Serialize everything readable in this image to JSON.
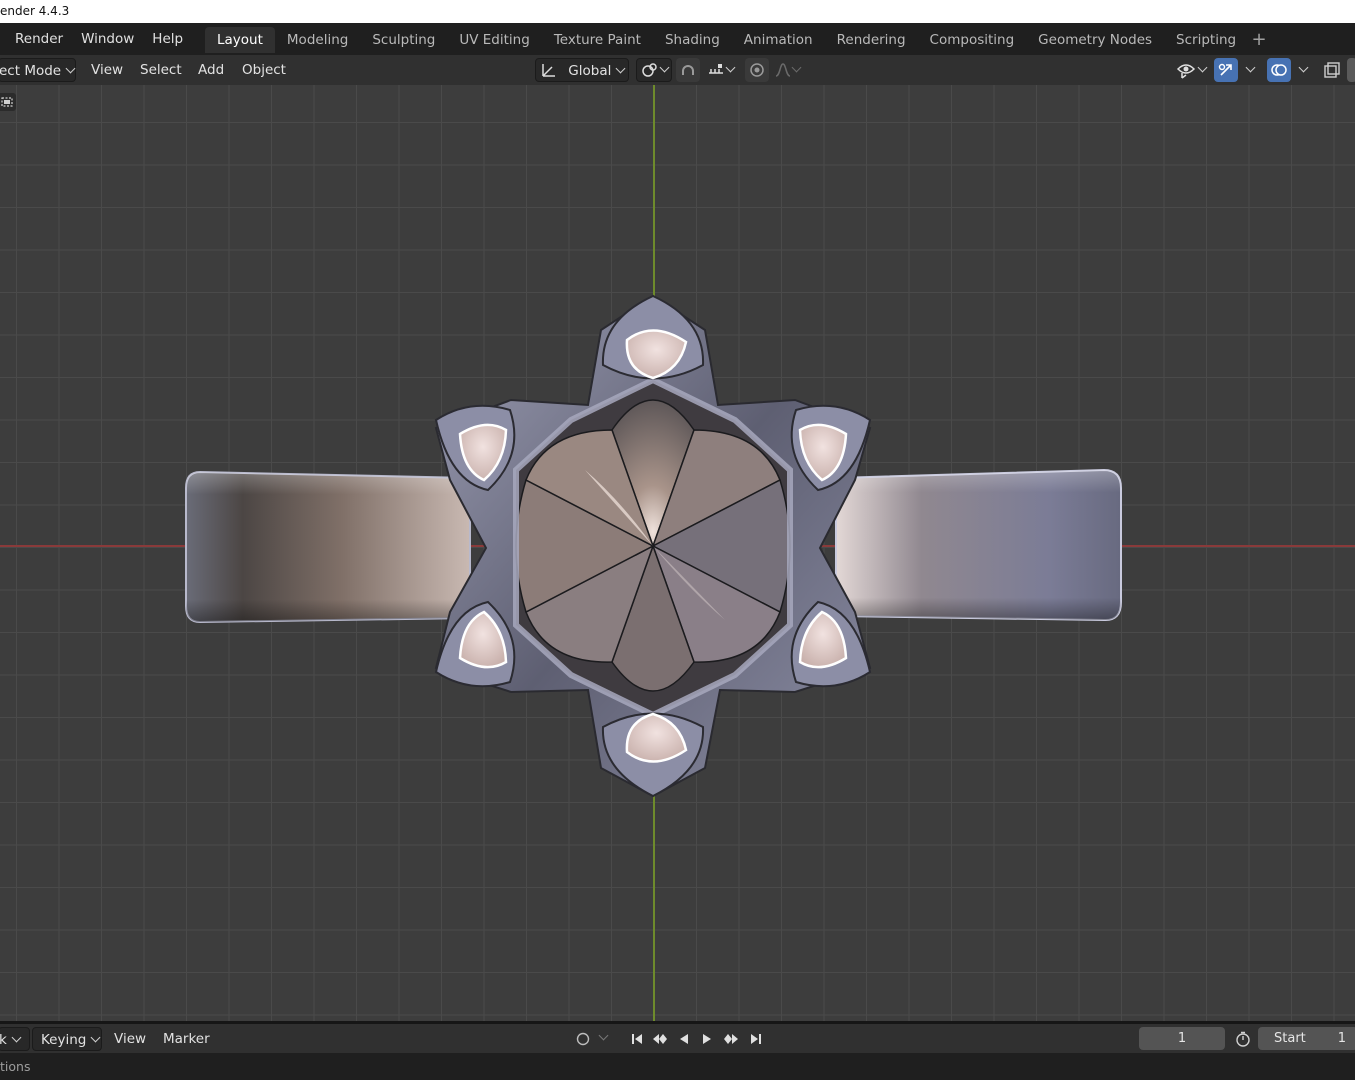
{
  "window": {
    "title": "ender 4.4.3"
  },
  "topbar": {
    "menus": [
      "Render",
      "Window",
      "Help"
    ],
    "tabs": [
      "Layout",
      "Modeling",
      "Sculpting",
      "UV Editing",
      "Texture Paint",
      "Shading",
      "Animation",
      "Rendering",
      "Compositing",
      "Geometry Nodes",
      "Scripting"
    ],
    "active_tab": "Layout",
    "add_tab_icon": "plus-icon"
  },
  "viewport_header": {
    "mode": "ect Mode",
    "menus": [
      "View",
      "Select",
      "Add",
      "Object"
    ],
    "orientation": "Global",
    "icons": [
      "transform-pivot-icon",
      "snap-link-icon",
      "snap-magnet-icon",
      "snap-increment-icon",
      "proportional-edit-icon",
      "falloff-curve-icon",
      "visibility-eye-icon",
      "gizmo-icon",
      "overlay-icon",
      "xray-icon"
    ]
  },
  "viewport": {
    "accent_colors": {
      "grid": "#4a4a4a",
      "background": "#3d3d3d",
      "axis_x": "#8a3a3a",
      "axis_y": "#6e8b2c"
    },
    "object": "ring-with-six-pointed-star-setting"
  },
  "timeline": {
    "mode_label": "k",
    "keying_label": "Keying",
    "menus": [
      "View",
      "Marker"
    ],
    "current_frame": "1",
    "start_label": "Start",
    "start_value": "1"
  },
  "status": {
    "text": "tions"
  }
}
